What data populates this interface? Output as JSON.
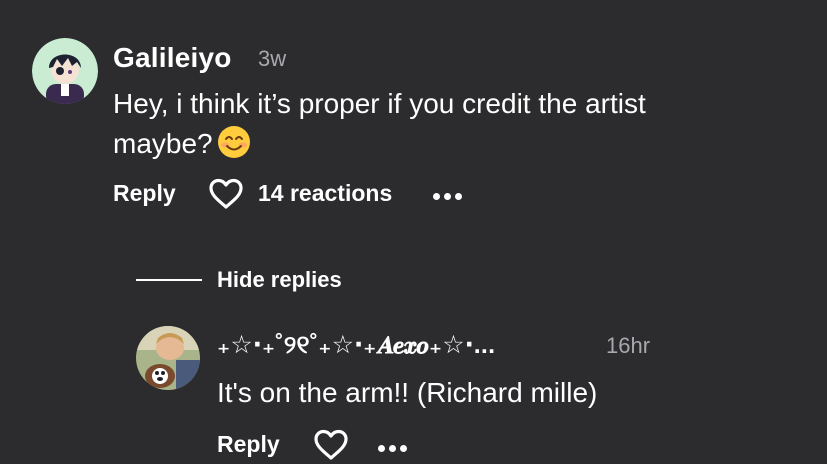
{
  "comment": {
    "username": "Galileiyo",
    "time": "3w",
    "text_line1": "Hey, i think it’s proper if you credit the artist",
    "text_line2": "maybe?",
    "emoji": "smiling-face-emoji",
    "reply_label": "Reply",
    "reactions_label": "14 reactions",
    "more_icon": "more-dots-icon",
    "heart_icon": "heart-outline-icon"
  },
  "replies_toggle": {
    "label": "Hide replies"
  },
  "reply": {
    "username": "₊☆‧₊˚୨୧˚₊☆‧₊𝑨𝒆𝒙𝒐₊☆‧...",
    "time": "16hr",
    "text": "It's on the arm!! (Richard mille)",
    "reply_label": "Reply",
    "heart_icon": "heart-outline-icon",
    "more_icon": "more-dots-icon"
  },
  "colors": {
    "background": "#2c2c2e",
    "text": "#ffffff",
    "secondary_text": "#a8a8ad"
  }
}
